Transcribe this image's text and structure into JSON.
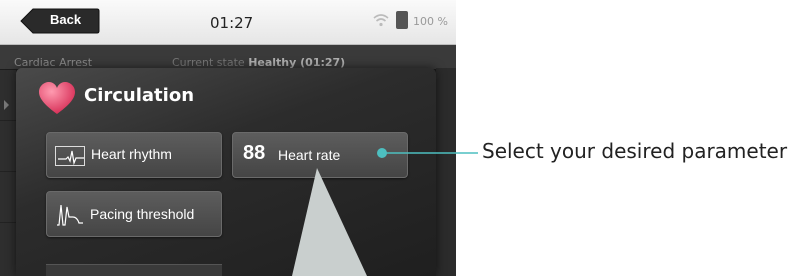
{
  "status_bar": {
    "back_label": "Back",
    "time": "01:27",
    "battery": "100 %"
  },
  "background_screen": {
    "scenario": "Cardiac Arrest",
    "state_label": "Current state",
    "state_value": "Healthy (01:27)"
  },
  "panel": {
    "title": "Circulation",
    "buttons": {
      "heart_rhythm": "Heart rhythm",
      "heart_rate_value": "88",
      "heart_rate": "Heart rate",
      "pacing_threshold": "Pacing threshold"
    }
  },
  "annotation": {
    "text": "Select your desired parameter"
  },
  "colors": {
    "accent": "#4dbfc0",
    "heart": "#e0476a",
    "panel": "#2c2c2c"
  }
}
